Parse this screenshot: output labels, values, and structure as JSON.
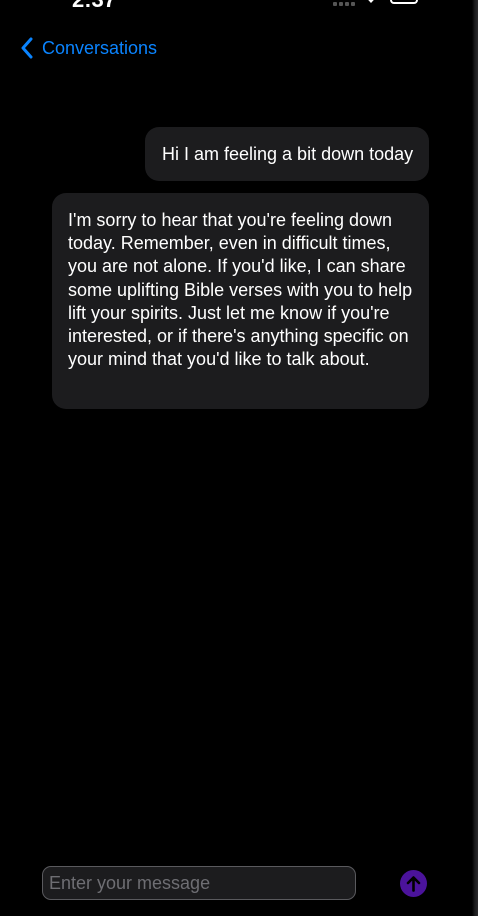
{
  "status_bar": {
    "time": "2:37"
  },
  "nav": {
    "back_label": "Conversations",
    "accent_color": "#0a84ff"
  },
  "messages": [
    {
      "role": "user",
      "text": "Hi I am feeling a bit down today"
    },
    {
      "role": "assistant",
      "text": "I'm sorry to hear that you're feeling down today. Remember, even in difficult times, you are not alone. If you'd like, I can share some uplifting Bible verses with you to help lift your spirits. Just let me know if you're interested, or if there's anything specific on your mind that you'd like to talk about."
    }
  ],
  "composer": {
    "placeholder": "Enter your message",
    "value": "",
    "send_button_color": "#4b139b",
    "send_icon": "arrow-up-icon"
  }
}
